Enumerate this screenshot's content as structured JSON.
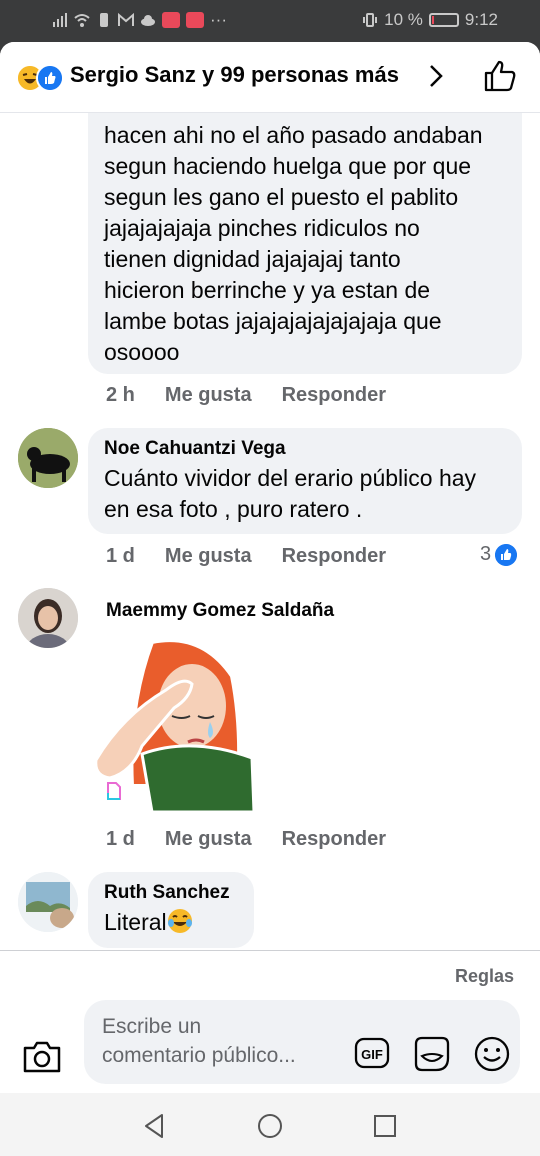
{
  "status_bar": {
    "battery_percent": "10 %",
    "time": "9:12",
    "battery_level": 0.1
  },
  "header": {
    "title": "Sergio Sanz y 99 personas más",
    "reactions": [
      "haha-icon",
      "like-icon"
    ]
  },
  "comments": [
    {
      "author": "",
      "text": "hacen ahi no el año pasado andaban\nsegun haciendo huelga que por que\nsegun les gano el puesto el pablito\njajajajajaja pinches ridiculos no\ntienen dignidad jajajajaj tanto\nhicieron berrinche y ya estan de\nlambe botas  jajajajajajajajaja que\nosoooo",
      "time": "2 h",
      "like_label": "Me gusta",
      "reply_label": "Responder"
    },
    {
      "author": "Noe Cahuantzi Vega",
      "text": "Cuánto vividor del erario público hay\nen esa foto , puro ratero .",
      "time": "1 d",
      "like_label": "Me gusta",
      "reply_label": "Responder",
      "reaction_count": "3"
    },
    {
      "author": "Maemmy Gomez Saldaña",
      "sticker": "crying-woman-sticker",
      "time": "1 d",
      "like_label": "Me gusta",
      "reply_label": "Responder"
    },
    {
      "author": "Ruth Sanchez",
      "text": "Literal",
      "emoji": "laughing-crying-emoji"
    }
  ],
  "footer": {
    "rules_label": "Reglas",
    "composer_placeholder": "Escribe un comentario público...",
    "composer_placeholder_line1": "Escribe un",
    "composer_placeholder_line2": "comentario público...",
    "gif_label": "GIF"
  },
  "colors": {
    "accent": "#1877f2",
    "bubble": "#f0f2f5",
    "muted_text": "#65676b",
    "status_bar": "#3a3b3c"
  }
}
